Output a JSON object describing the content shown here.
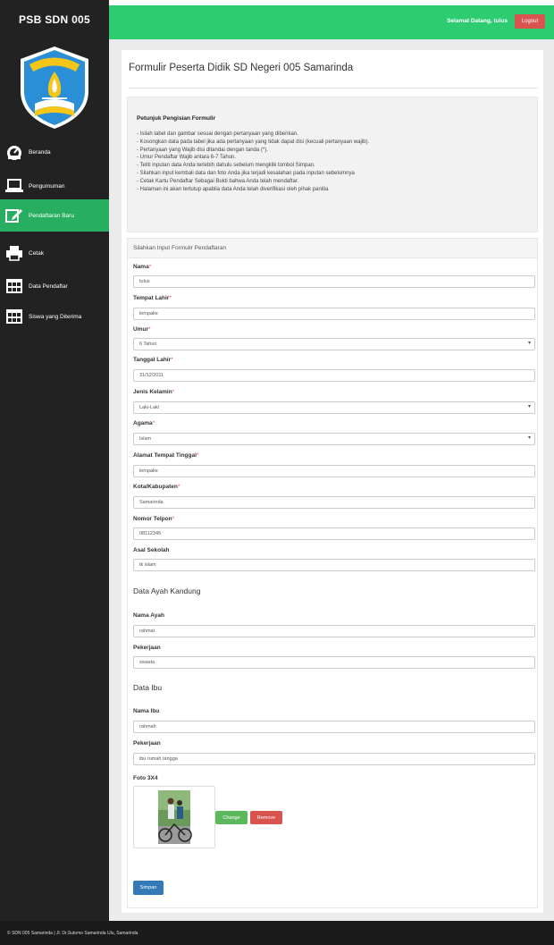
{
  "sidebar": {
    "brand": "PSB SDN 005",
    "logo_text": "TUT WURI HANDAYANI",
    "items": [
      {
        "label": "Beranda",
        "icon": "dashboard-icon"
      },
      {
        "label": "Pengumuman",
        "icon": "laptop-icon"
      },
      {
        "label": "Pendaftaran Baru",
        "icon": "edit-icon"
      },
      {
        "label": "Cetak",
        "icon": "printer-icon"
      },
      {
        "label": "Data Pendaftar",
        "icon": "table-icon"
      },
      {
        "label": "Siswa yang Diterima",
        "icon": "table-icon"
      }
    ]
  },
  "header": {
    "welcome": "Selamat Datang, tulus",
    "logout": "Logout"
  },
  "page": {
    "title": "Formulir Peserta Didik SD Negeri 005 Samarinda"
  },
  "instructions": {
    "title": "Petunjuk Pengisian Formulir",
    "items": [
      "- Isilah tabel dan gambar sesuai dengan pertanyaan yang diberikan.",
      "- Kosongkan data pada tabel jika ada pertanyaan yang tidak dapat disi (kecuali pertanyaan wajib).",
      "- Pertanyaan yang Wajib disi ditandai dengan tanda (*).",
      "- Umur Pendaftar Wajib antara 6-7 Tahun.",
      "- Teliti inputan data Anda terlebih dahulu sebelum mengklik tombol Simpan.",
      "- Silahkan input kembali data dan foto Anda jika terjadi kesalahan pada inputan sebelumnya",
      "- Cetak Kartu Pendaftar Sebagai Bukti bahwa Anda telah mendaftar.",
      "- Halaman ini akan tertutup apabila data Anda telah diverifikasi oleh pihak panitia"
    ]
  },
  "form": {
    "heading": "Silahkan Input Formulir Pendaftaran",
    "nama": {
      "label": "Nama",
      "value": "tulus"
    },
    "tempat_lahir": {
      "label": "Tempat Lahir",
      "value": "lempake"
    },
    "umur": {
      "label": "Umur",
      "value": "6 Tahun"
    },
    "tanggal_lahir": {
      "label": "Tanggal Lahir",
      "value": "31/12/2011"
    },
    "jenis_kelamin": {
      "label": "Jenis Kelamin",
      "value": "Laki-Laki"
    },
    "agama": {
      "label": "Agama",
      "value": "Islam"
    },
    "alamat": {
      "label": "Alamat Tempat Tinggal",
      "value": "lempake"
    },
    "kota": {
      "label": "Kota/Kabupaten",
      "value": "Samarinda"
    },
    "telpon": {
      "label": "Nomor Telpon",
      "value": "08112345"
    },
    "asal_sekolah": {
      "label": "Asal Sekolah",
      "value": "tk islam"
    },
    "ayah_section": "Data Ayah Kandung",
    "nama_ayah": {
      "label": "Nama Ayah",
      "value": "rahmat"
    },
    "pekerjaan_ayah": {
      "label": "Pekerjaan",
      "value": "swasta"
    },
    "ibu_section": "Data Ibu",
    "nama_ibu": {
      "label": "Nama Ibu",
      "value": "rahmah"
    },
    "pekerjaan_ibu": {
      "label": "Pekerjaan",
      "value": "ibu rumah tangga"
    },
    "foto_label": "Foto 3X4",
    "change": "Change",
    "remove": "Remove",
    "save": "Simpan",
    "required_mark": "*"
  },
  "footer": "© SDN 005 Samarinda | Jl. Dr.Sutomo Samarinda Ulu, Samarinda",
  "colors": {
    "sidebar": "#222222",
    "accent_green": "#2ecc71",
    "active_green": "#27ae60",
    "danger": "#d9534f",
    "primary": "#337ab7",
    "success": "#5cb85c"
  }
}
